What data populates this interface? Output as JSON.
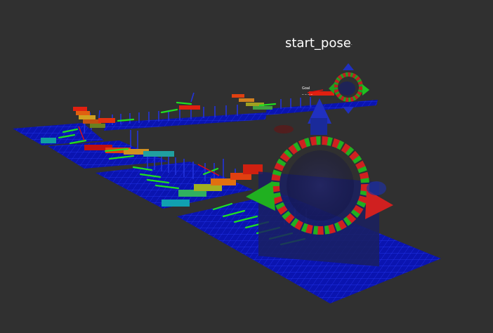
{
  "viewer": {
    "background_color": "#303030",
    "labels": {
      "start_pose": "start_pose",
      "start_pose_small": "- - - - -",
      "far_marker_line1": "Goal",
      "far_marker_line2": "_ _ _ _"
    },
    "colors": {
      "grid_plane": "#0a14b4",
      "grid_lines": "#1e32ff",
      "axis_red": "#e01010",
      "axis_green": "#10c010",
      "axis_blue": "#2030c0",
      "pose_box": "#1a2060"
    }
  }
}
